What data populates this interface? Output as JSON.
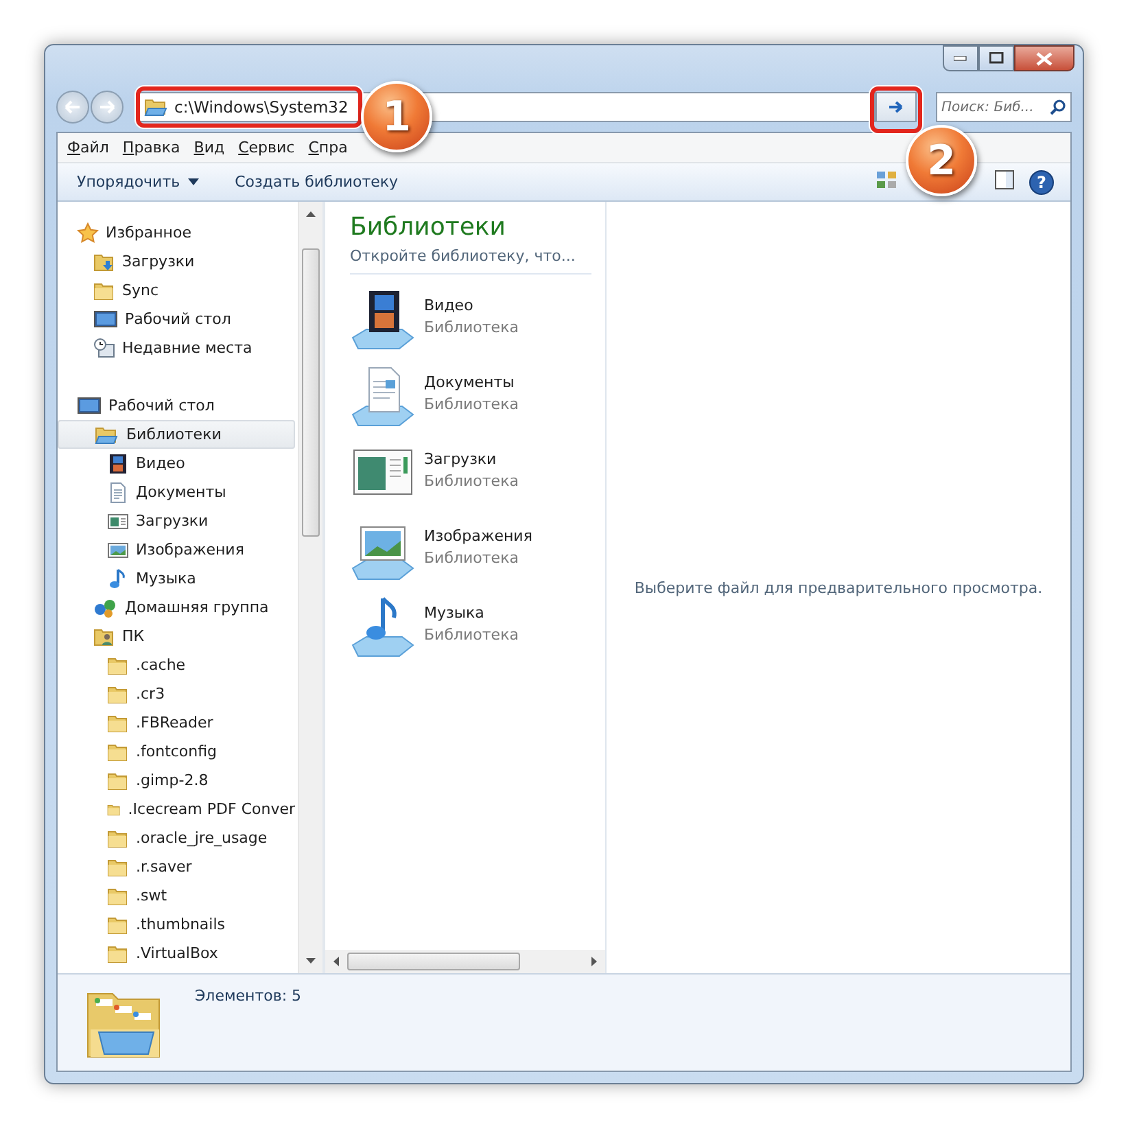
{
  "address": {
    "path": "c:\\Windows\\System32"
  },
  "search": {
    "placeholder": "Поиск: Биб..."
  },
  "menu": [
    "Файл",
    "Правка",
    "Вид",
    "Сервис",
    "Спра"
  ],
  "toolbar": [
    {
      "label": "Упорядочить",
      "kind": "dropdown"
    },
    {
      "label": "Создать библиотеку",
      "kind": "button"
    }
  ],
  "tree": [
    {
      "label": "Избранное",
      "kind": "star",
      "selected": false,
      "children": [
        {
          "label": "Загрузки",
          "kind": "downloads",
          "selected": false
        },
        {
          "label": "Sync",
          "kind": "folder",
          "selected": false
        },
        {
          "label": "Рабочий стол",
          "kind": "desktop",
          "selected": false
        },
        {
          "label": "Недавние места",
          "kind": "recent",
          "selected": false
        }
      ]
    },
    {
      "label": "Рабочий стол",
      "kind": "desktop",
      "selected": false,
      "children": [
        {
          "label": "Библиотеки",
          "kind": "library",
          "selected": true,
          "children": [
            {
              "label": "Видео",
              "kind": "video",
              "selected": false
            },
            {
              "label": "Документы",
              "kind": "doc",
              "selected": false
            },
            {
              "label": "Загрузки",
              "kind": "window",
              "selected": false
            },
            {
              "label": "Изображения",
              "kind": "pics",
              "selected": false
            },
            {
              "label": "Музыка",
              "kind": "music",
              "selected": false
            }
          ]
        },
        {
          "label": "Домашняя группа",
          "kind": "homegroup",
          "selected": false
        },
        {
          "label": "ПК",
          "kind": "pc",
          "selected": false,
          "children": [
            {
              "label": ".cache",
              "kind": "folder",
              "selected": false
            },
            {
              "label": ".cr3",
              "kind": "folder",
              "selected": false
            },
            {
              "label": ".FBReader",
              "kind": "folder",
              "selected": false
            },
            {
              "label": ".fontconfig",
              "kind": "folder",
              "selected": false
            },
            {
              "label": ".gimp-2.8",
              "kind": "folder",
              "selected": false
            },
            {
              "label": ".Icecream PDF Conver",
              "kind": "folder",
              "selected": false
            },
            {
              "label": ".oracle_jre_usage",
              "kind": "folder",
              "selected": false
            },
            {
              "label": ".r.saver",
              "kind": "folder",
              "selected": false
            },
            {
              "label": ".swt",
              "kind": "folder",
              "selected": false
            },
            {
              "label": ".thumbnails",
              "kind": "folder",
              "selected": false
            },
            {
              "label": ".VirtualBox",
              "kind": "folder",
              "selected": false
            }
          ]
        }
      ]
    }
  ],
  "libraries": {
    "title": "Библиотеки",
    "subtitle": "Откройте библиотеку, что...",
    "items": [
      {
        "name": "Видео",
        "type": "Библиотека",
        "kind": "video"
      },
      {
        "name": "Документы",
        "type": "Библиотека",
        "kind": "doc"
      },
      {
        "name": "Загрузки",
        "type": "Библиотека",
        "kind": "window"
      },
      {
        "name": "Изображения",
        "type": "Библиотека",
        "kind": "pics"
      },
      {
        "name": "Музыка",
        "type": "Библиотека",
        "kind": "music"
      }
    ]
  },
  "preview": {
    "message": "Выберите файл для предварительного просмотра."
  },
  "status_bar": {
    "count": "Элементов: 5"
  },
  "help": {
    "label": "?"
  },
  "callouts": [
    {
      "label": "1"
    },
    {
      "label": "2"
    }
  ]
}
